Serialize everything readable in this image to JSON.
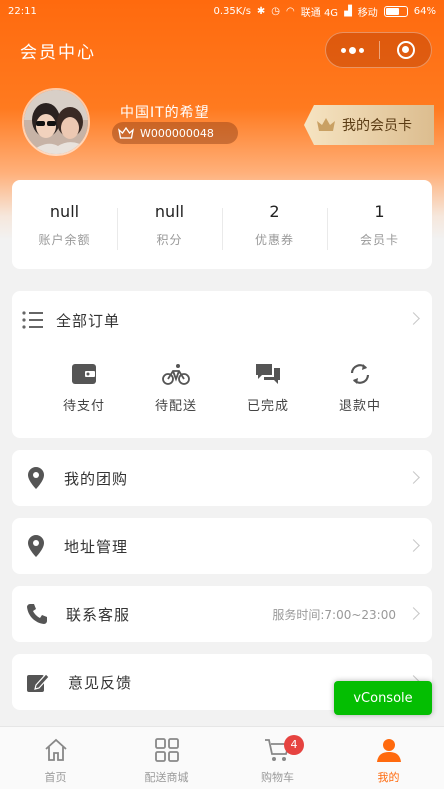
{
  "status_bar": {
    "time": "22:11",
    "network_speed": "0.35K/s",
    "carrier_1": "联通 4G",
    "carrier_2": "移动",
    "battery": "64%",
    "battery_level": 0.64
  },
  "header": {
    "title": "会员中心"
  },
  "profile": {
    "name": "中国IT的希望",
    "member_id": "W000000048",
    "card_button": "我的会员卡"
  },
  "stats": [
    {
      "value": "null",
      "label": "账户余额"
    },
    {
      "value": "null",
      "label": "积分"
    },
    {
      "value": "2",
      "label": "优惠券"
    },
    {
      "value": "1",
      "label": "会员卡"
    }
  ],
  "orders": {
    "title": "全部订单",
    "items": [
      {
        "label": "待支付",
        "icon": "wallet-icon"
      },
      {
        "label": "待配送",
        "icon": "bicycle-icon"
      },
      {
        "label": "已完成",
        "icon": "chat-icon"
      },
      {
        "label": "退款中",
        "icon": "refresh-icon"
      }
    ]
  },
  "menu": {
    "group_buy": "我的团购",
    "address": "地址管理",
    "service": "联系客服",
    "service_hours": "服务时间:7:00~23:00",
    "feedback": "意见反馈"
  },
  "tabbar": [
    {
      "label": "首页",
      "icon": "home-icon"
    },
    {
      "label": "配送商城",
      "icon": "grid-icon"
    },
    {
      "label": "购物车",
      "icon": "cart-icon",
      "badge": "4"
    },
    {
      "label": "我的",
      "icon": "user-icon",
      "active": true
    }
  ],
  "vconsole": "vConsole",
  "colors": {
    "accent": "#ff6a0e",
    "gold": "#dcbd8f",
    "badge": "#e64340",
    "vconsole": "#04be02"
  }
}
